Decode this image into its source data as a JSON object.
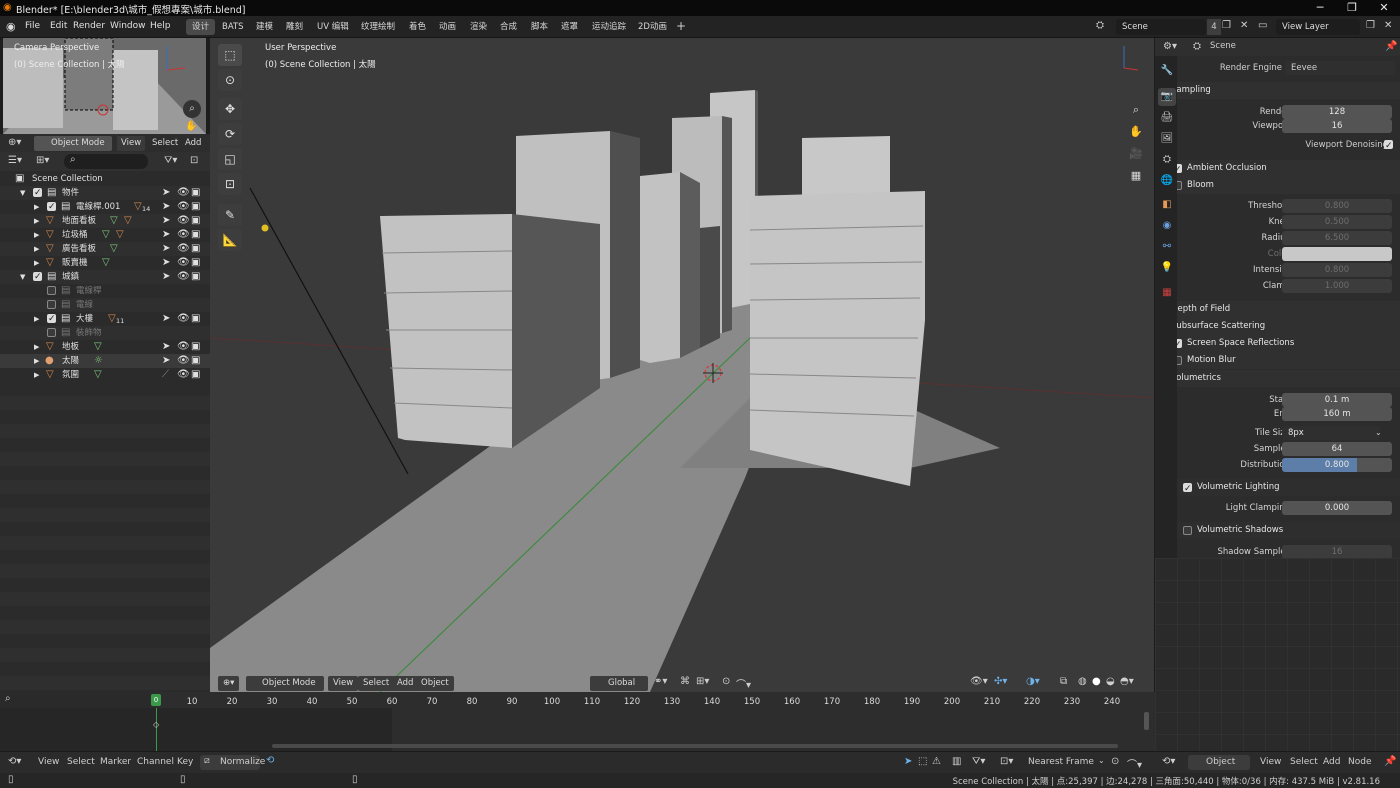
{
  "window": {
    "title": "Blender* [E:\\blender3d\\城市_假想專案\\城市.blend]"
  },
  "menus": [
    "File",
    "Edit",
    "Render",
    "Window",
    "Help"
  ],
  "workspaces": [
    "设计",
    "BATS",
    "建模",
    "雕刻",
    "UV 编辑",
    "纹理绘制",
    "着色",
    "动画",
    "渲染",
    "合成",
    "脚本",
    "遮罩",
    "运动追踪",
    "2D动画"
  ],
  "topright": {
    "scene": "Scene",
    "scene_count": "4",
    "view_layer": "View Layer"
  },
  "camera_thumb": {
    "title": "Camera Perspective",
    "subtitle": "(0) Scene Collection | 太陽"
  },
  "left_header": {
    "mode": "Object Mode",
    "view": "View",
    "select": "Select",
    "add": "Add"
  },
  "outliner": {
    "root": "Scene Collection",
    "rows": [
      {
        "name": "物件",
        "badge": ""
      },
      {
        "name": "電線桿.001",
        "badge": "14"
      },
      {
        "name": "地面看板",
        "badge": ""
      },
      {
        "name": "垃圾桶",
        "badge": ""
      },
      {
        "name": "廣告看板",
        "badge": ""
      },
      {
        "name": "販賣機",
        "badge": ""
      },
      {
        "name": "城鎮",
        "badge": ""
      },
      {
        "name": "電線桿",
        "badge": ""
      },
      {
        "name": "電線",
        "badge": ""
      },
      {
        "name": "大樓",
        "badge": "11"
      },
      {
        "name": "裝飾物",
        "badge": ""
      },
      {
        "name": "地板",
        "badge": ""
      },
      {
        "name": "太陽",
        "badge": ""
      },
      {
        "name": "氛圍",
        "badge": ""
      }
    ]
  },
  "viewport": {
    "title": "User Perspective",
    "subtitle": "(0) Scene Collection | 太陽",
    "mode": "Object Mode",
    "view": "View",
    "select": "Select",
    "add": "Add",
    "object": "Object",
    "orientation": "Global"
  },
  "properties": {
    "title": "Scene",
    "render_engine_label": "Render Engine",
    "render_engine": "Eevee",
    "sampling": "Sampling",
    "render_label": "Render",
    "render_val": "128",
    "viewport_label": "Viewport",
    "viewport_val": "16",
    "denoise": "Viewport Denoising",
    "ao": "Ambient Occlusion",
    "bloom": "Bloom",
    "threshold_label": "Threshold",
    "threshold": "0.800",
    "knee_label": "Knee",
    "knee": "0.500",
    "radius_label": "Radius",
    "radius": "6.500",
    "color_label": "Color",
    "intensity_label": "Intensity",
    "intensity": "0.800",
    "clamp_label": "Clamp",
    "clamp": "1.000",
    "dof": "Depth of Field",
    "sss": "Subsurface Scattering",
    "ssr": "Screen Space Reflections",
    "motion_blur": "Motion Blur",
    "volumetrics": "Volumetrics",
    "start_label": "Start",
    "start": "0.1 m",
    "end_label": "End",
    "end": "160 m",
    "tile_label": "Tile Size",
    "tile": "8px",
    "samples_label": "Samples",
    "samples": "64",
    "dist_label": "Distribution",
    "dist": "0.800",
    "vol_light": "Volumetric Lighting",
    "light_clamp_label": "Light Clamping",
    "light_clamp": "0.000",
    "vol_shadows": "Volumetric Shadows",
    "shadow_samples_label": "Shadow Samples",
    "shadow_samples": "16"
  },
  "timeline": {
    "ticks": [
      "10",
      "20",
      "30",
      "40",
      "50",
      "60",
      "70",
      "80",
      "90",
      "100",
      "110",
      "120",
      "130",
      "140",
      "150",
      "160",
      "170",
      "180",
      "190",
      "200",
      "210",
      "220",
      "230",
      "240"
    ],
    "current": "0"
  },
  "bottombar": {
    "view": "View",
    "select": "Select",
    "marker": "Marker",
    "channel": "Channel",
    "key": "Key",
    "normalize": "Normalize",
    "nearest": "Nearest Frame",
    "right_mode": "Object",
    "r_view": "View",
    "r_select": "Select",
    "r_add": "Add",
    "r_node": "Node"
  },
  "statusbar": {
    "info": "Scene Collection | 太陽 | 点:25,397 | 边:24,278 | 三角面:50,440 | 物体:0/36 | 内存: 437.5 MiB | v2.81.16"
  }
}
